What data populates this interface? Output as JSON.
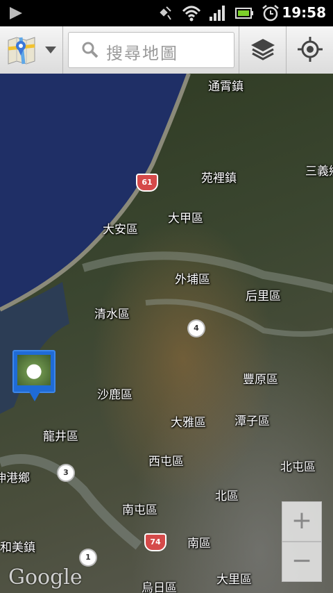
{
  "status_bar": {
    "time": "19:58"
  },
  "toolbar": {
    "search_placeholder": "搜尋地圖",
    "icons": [
      "maps-app-icon",
      "dropdown-icon",
      "search-icon",
      "layers-icon",
      "my-location-icon"
    ]
  },
  "map": {
    "places": [
      {
        "id": "tongxiao",
        "label": "通霄鎮"
      },
      {
        "id": "yuanli",
        "label": "苑裡鎮"
      },
      {
        "id": "sanyi",
        "label": "三義鄉"
      },
      {
        "id": "daan",
        "label": "大安區"
      },
      {
        "id": "dajia",
        "label": "大甲區"
      },
      {
        "id": "waipu",
        "label": "外埔區"
      },
      {
        "id": "houli",
        "label": "后里區"
      },
      {
        "id": "qingshui",
        "label": "清水區"
      },
      {
        "id": "fengyuan",
        "label": "豐原區"
      },
      {
        "id": "shalu",
        "label": "沙鹿區"
      },
      {
        "id": "daya",
        "label": "大雅區"
      },
      {
        "id": "tanzi",
        "label": "潭子區"
      },
      {
        "id": "longjing",
        "label": "龍井區"
      },
      {
        "id": "xitun",
        "label": "西屯區"
      },
      {
        "id": "beitun",
        "label": "北屯區"
      },
      {
        "id": "xianggang",
        "label": "伸港鄉"
      },
      {
        "id": "beiqu",
        "label": "北區"
      },
      {
        "id": "nantun",
        "label": "南屯區"
      },
      {
        "id": "nanqu",
        "label": "南區"
      },
      {
        "id": "hemei",
        "label": "和美鎮"
      },
      {
        "id": "wuri",
        "label": "烏日區"
      },
      {
        "id": "dali",
        "label": "大里區"
      }
    ],
    "road_shields": [
      {
        "id": "r61",
        "label": "61"
      },
      {
        "id": "r74",
        "label": "74"
      },
      {
        "id": "r4",
        "label": "4"
      },
      {
        "id": "r3",
        "label": "3"
      },
      {
        "id": "r1",
        "label": "1"
      }
    ],
    "zoom_in_label": "+",
    "zoom_out_label": "−",
    "attribution": "Google"
  }
}
